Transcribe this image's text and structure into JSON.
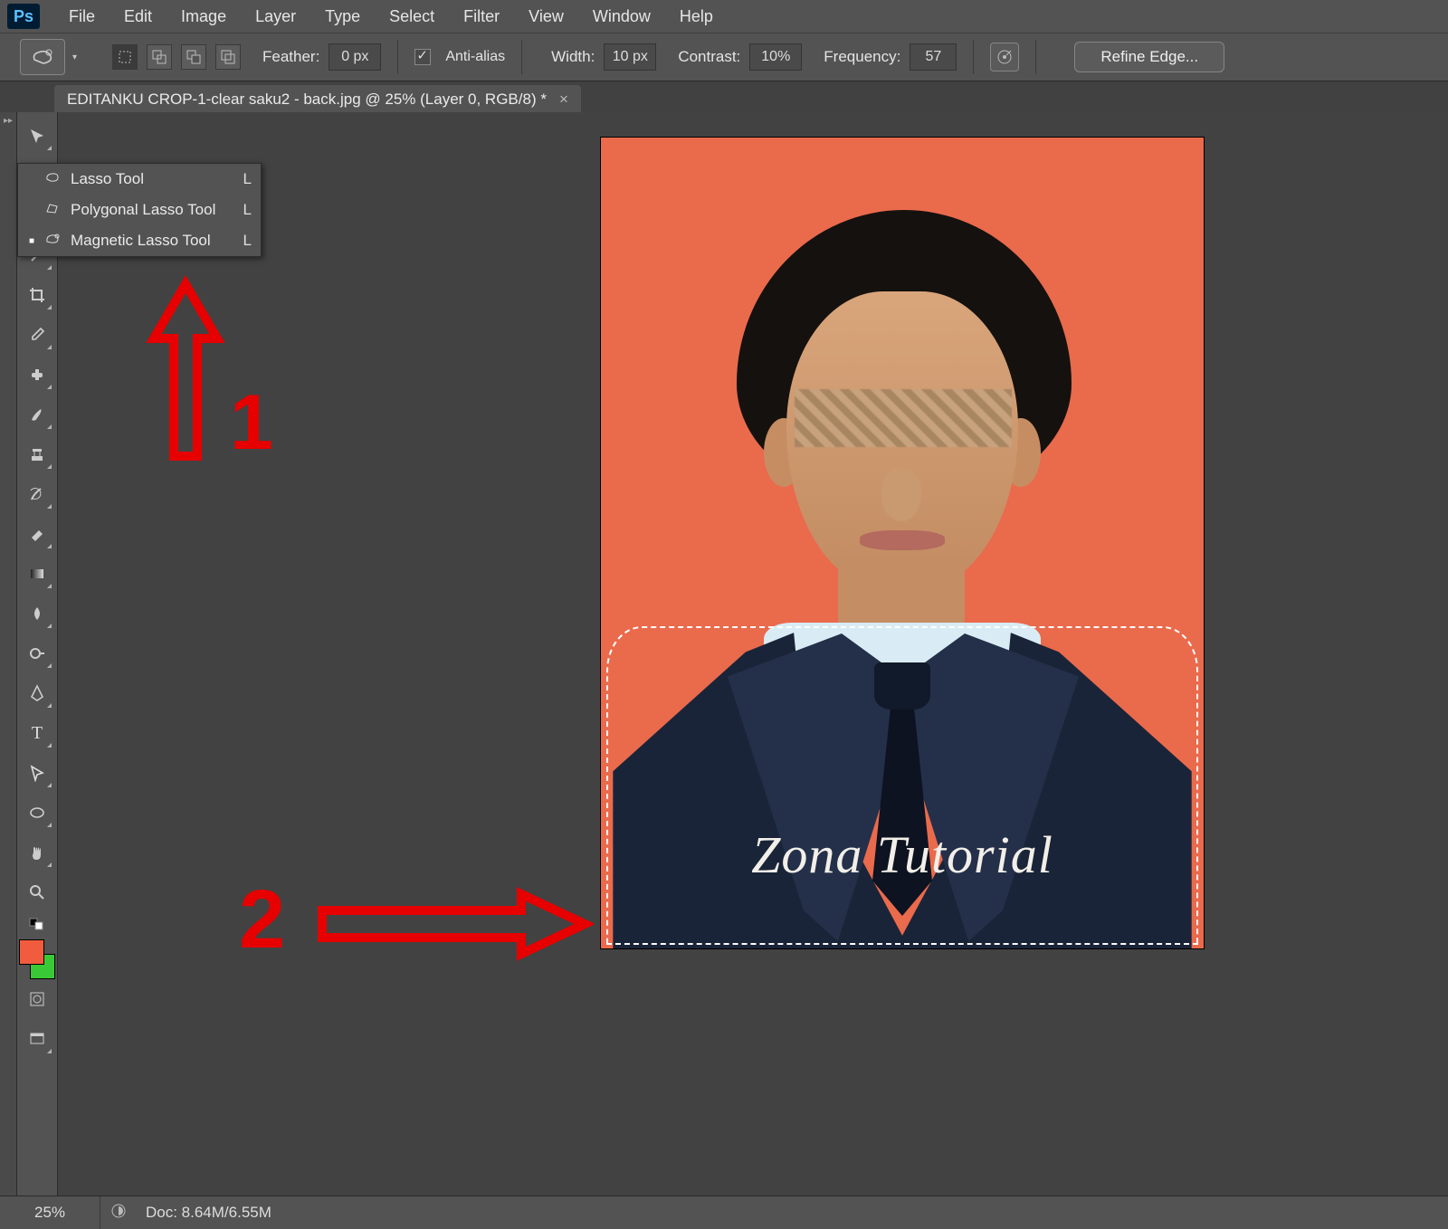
{
  "menu": [
    "File",
    "Edit",
    "Image",
    "Layer",
    "Type",
    "Select",
    "Filter",
    "View",
    "Window",
    "Help"
  ],
  "options": {
    "feather_label": "Feather:",
    "feather": "0 px",
    "aa_label": "Anti-alias",
    "aa_checked": true,
    "width_label": "Width:",
    "width": "10 px",
    "contrast_label": "Contrast:",
    "contrast": "10%",
    "frequency_label": "Frequency:",
    "frequency": "57",
    "refine": "Refine Edge..."
  },
  "tab": {
    "title": "EDITANKU CROP-1-clear saku2 - back.jpg @ 25% (Layer 0, RGB/8) *"
  },
  "flyout": [
    {
      "name": "Lasso Tool",
      "key": "L",
      "active": false
    },
    {
      "name": "Polygonal Lasso Tool",
      "key": "L",
      "active": false
    },
    {
      "name": "Magnetic Lasso Tool",
      "key": "L",
      "active": true
    }
  ],
  "annotations": {
    "num1": "1",
    "num2": "2"
  },
  "canvas": {
    "watermark": "Zona Tutorial"
  },
  "swatch": {
    "fg": "#f15c3e",
    "bg": "#3ac936"
  },
  "status": {
    "zoom": "25%",
    "doc": "Doc: 8.64M/6.55M"
  }
}
